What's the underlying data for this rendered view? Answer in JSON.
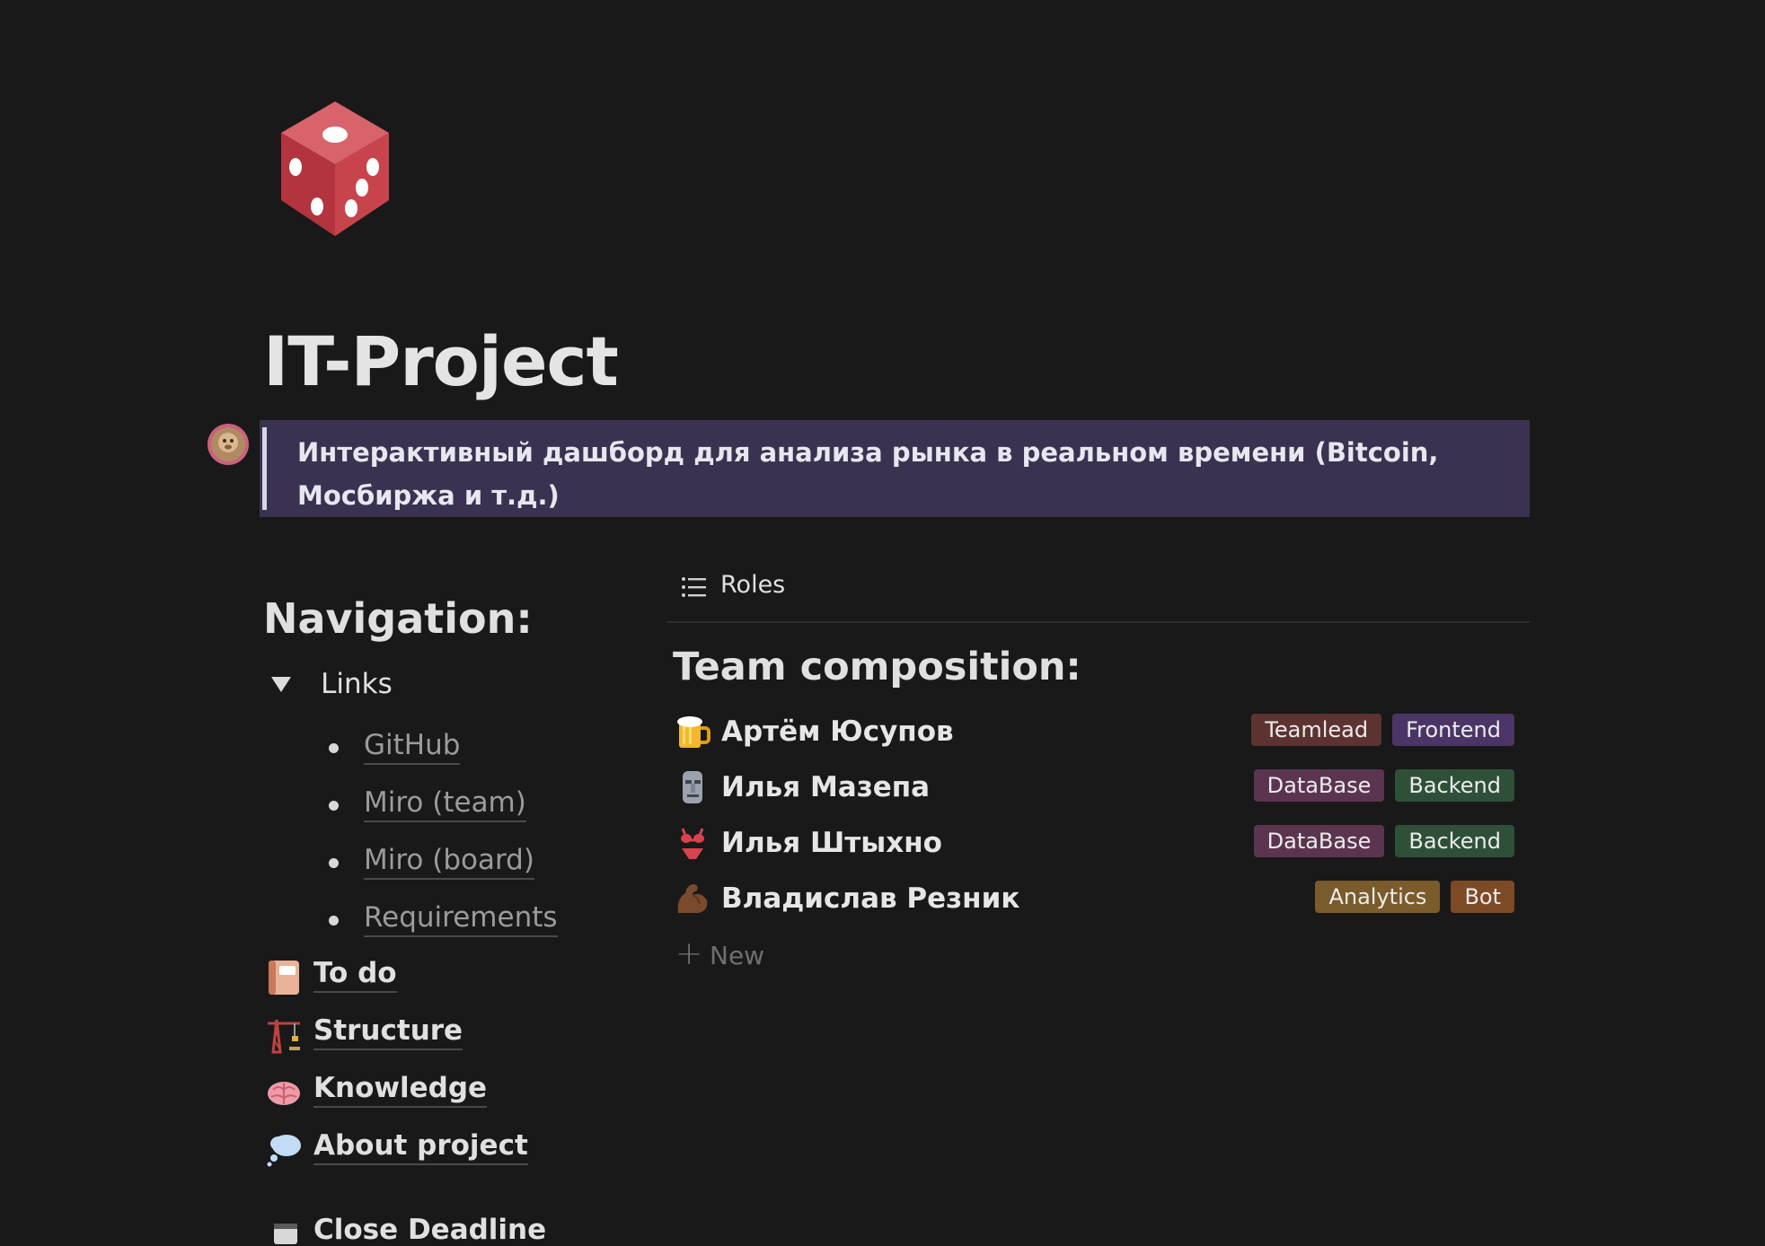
{
  "page": {
    "icon": "game-die-icon",
    "title": "IT-Project",
    "callout": {
      "author_icon": "avatar-icon",
      "text": "Интерактивный дашборд для анализа рынка в реальном времени (Bitcoin, Мосбиржа и т.д.)"
    }
  },
  "navigation": {
    "heading": "Navigation:",
    "toggle": {
      "label": "Links",
      "expanded": true,
      "links": [
        {
          "label": "GitHub"
        },
        {
          "label": "Miro (team)"
        },
        {
          "label": "Miro (board)"
        },
        {
          "label": "Requirements"
        }
      ]
    },
    "pages": [
      {
        "label": "To do",
        "icon": "notebook-icon"
      },
      {
        "label": "Structure",
        "icon": "construction-crane-icon"
      },
      {
        "label": "Knowledge",
        "icon": "brain-icon"
      },
      {
        "label": "About project",
        "icon": "thought-balloon-icon"
      },
      {
        "label": "Close Deadline",
        "icon": "calendar-icon"
      }
    ]
  },
  "roles_view": {
    "view_name": "Roles",
    "view_icon": "list-icon",
    "heading": "Team composition:",
    "members": [
      {
        "name": "Артём Юсупов",
        "icon": "beer-mug-icon",
        "tags": [
          {
            "label": "Teamlead",
            "color": "#5c3330"
          },
          {
            "label": "Frontend",
            "color": "#4b3566"
          }
        ]
      },
      {
        "name": "Илья Мазепа",
        "icon": "moai-icon",
        "tags": [
          {
            "label": "DataBase",
            "color": "#5b3550"
          },
          {
            "label": "Backend",
            "color": "#2f5038"
          }
        ]
      },
      {
        "name": "Илья Штыхно",
        "icon": "bikini-icon",
        "tags": [
          {
            "label": "DataBase",
            "color": "#5b3550"
          },
          {
            "label": "Backend",
            "color": "#2f5038"
          }
        ]
      },
      {
        "name": "Владислав Резник",
        "icon": "flexed-biceps-icon",
        "tags": [
          {
            "label": "Analytics",
            "color": "#7a5b2c"
          },
          {
            "label": "Bot",
            "color": "#7d4a26"
          }
        ]
      }
    ],
    "new_label": "New"
  },
  "colors": {
    "background": "#191919",
    "callout_background": "#3a3250",
    "text_primary": "#e0e0e0",
    "text_muted": "#9b9b9b"
  }
}
